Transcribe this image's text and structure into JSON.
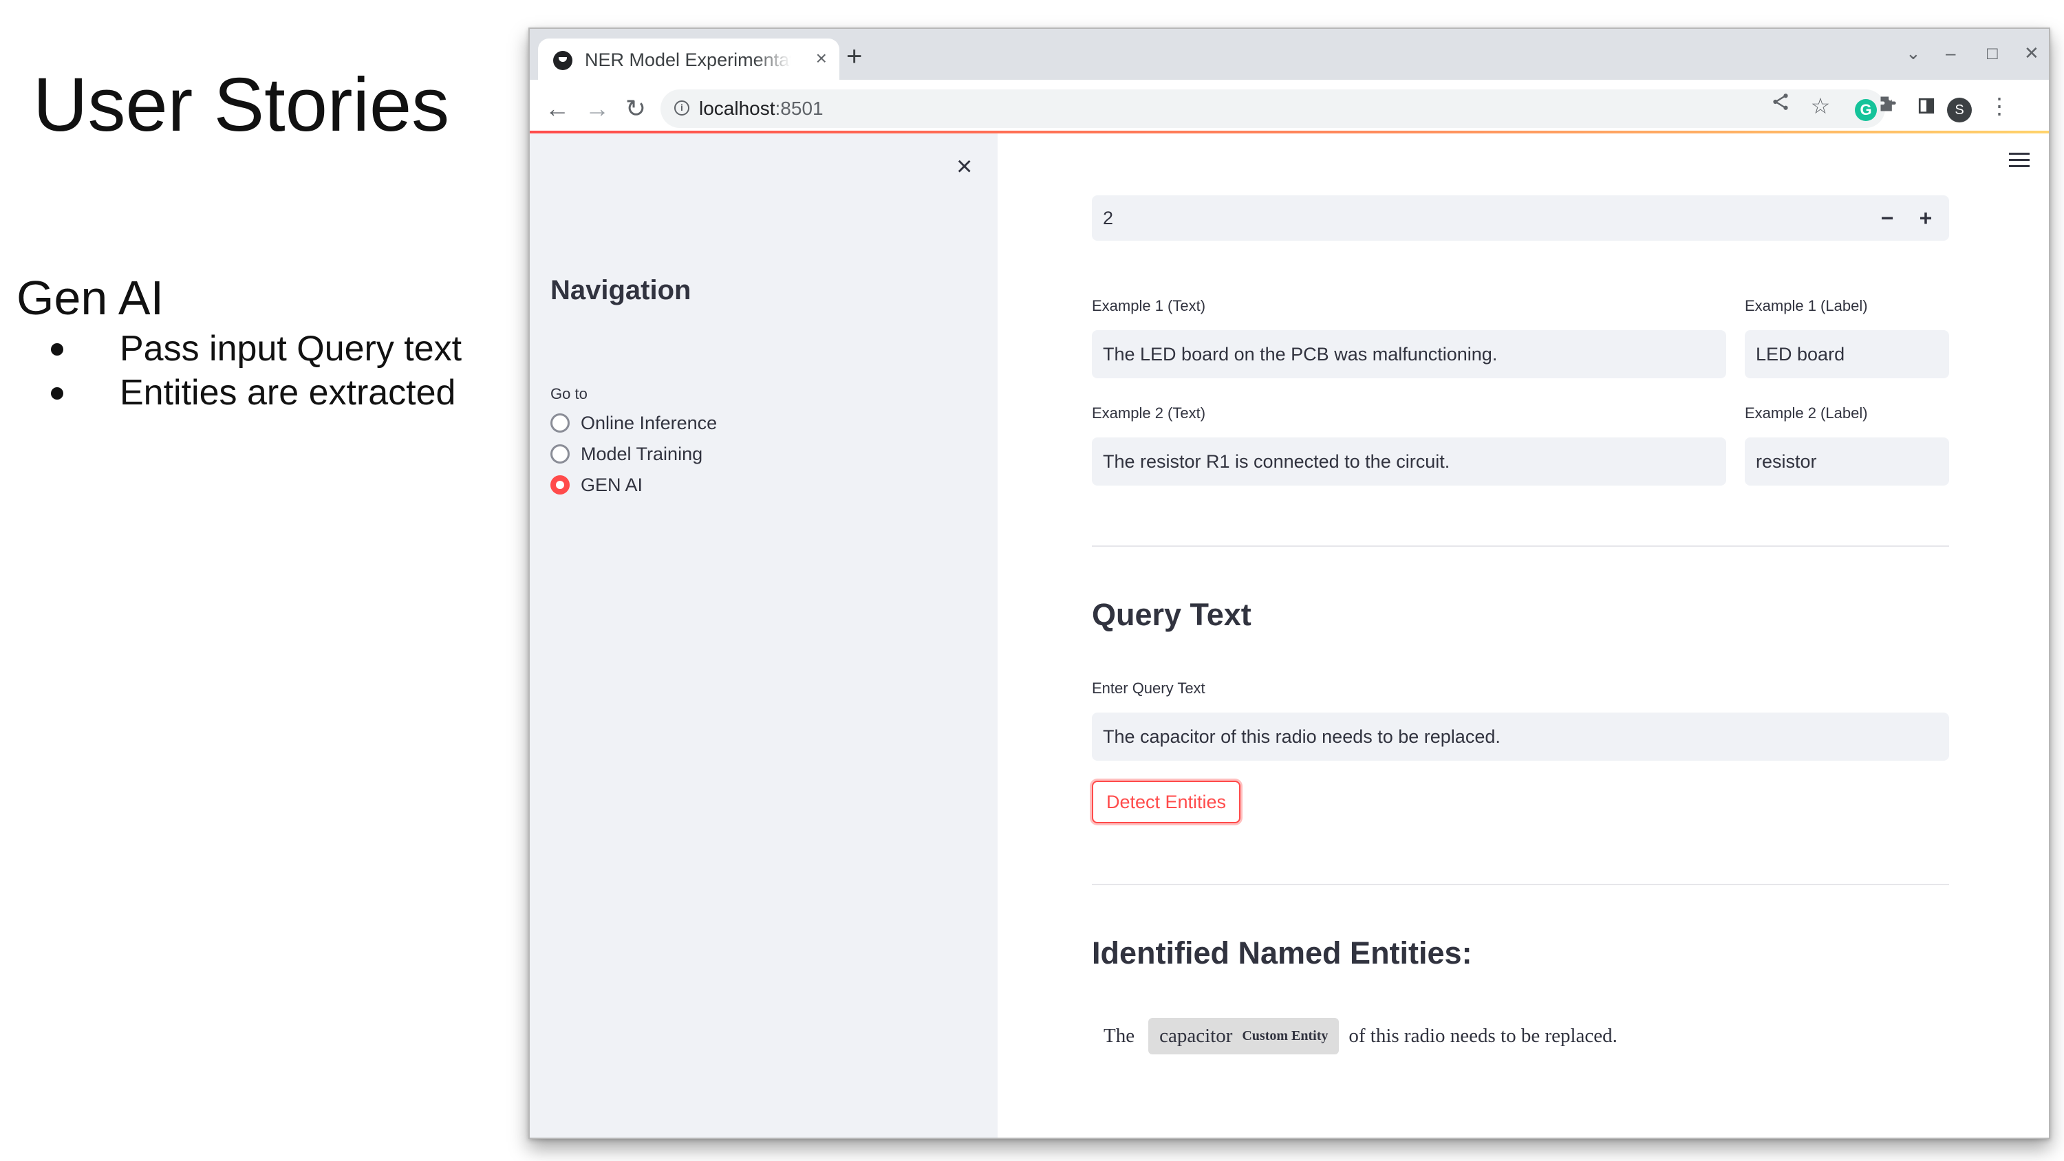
{
  "slide": {
    "title": "User Stories",
    "subtitle": "Gen AI",
    "bullets": [
      "Pass input Query text",
      "Entities are extracted"
    ]
  },
  "browser": {
    "tab_title": "NER Model Experimentati",
    "tab_close": "×",
    "new_tab": "+",
    "url_host": "localhost",
    "url_port": ":8501",
    "avatar_letter": "S",
    "grammarly_letter": "G"
  },
  "sidebar": {
    "close": "×",
    "title": "Navigation",
    "goto_label": "Go to",
    "options": [
      {
        "label": "Online Inference",
        "selected": false
      },
      {
        "label": "Model Training",
        "selected": false
      },
      {
        "label": "GEN AI",
        "selected": true
      }
    ]
  },
  "main": {
    "num_examples": "2",
    "stepper_minus": "−",
    "stepper_plus": "+",
    "examples": [
      {
        "text_label": "Example 1 (Text)",
        "text": "The LED board on the PCB was malfunctioning.",
        "label_label": "Example 1 (Label)",
        "label": "LED board"
      },
      {
        "text_label": "Example 2 (Text)",
        "text": "The resistor R1 is connected to the circuit.",
        "label_label": "Example 2 (Label)",
        "label": "resistor"
      }
    ],
    "query_heading": "Query Text",
    "query_label": "Enter Query Text",
    "query_value": "The capacitor of this radio needs to be replaced.",
    "detect_button": "Detect Entities",
    "entities_heading": "Identified Named Entities:",
    "result": {
      "before": "The",
      "entity_text": "capacitor",
      "entity_type": "Custom Entity",
      "after": "of this radio needs to be replaced."
    }
  },
  "colors": {
    "accent": "#ff4b4b",
    "sidebar_bg": "#f0f2f6",
    "field_bg": "#f0f2f6",
    "text": "#31333f",
    "entity_chip": "#dddddd"
  }
}
